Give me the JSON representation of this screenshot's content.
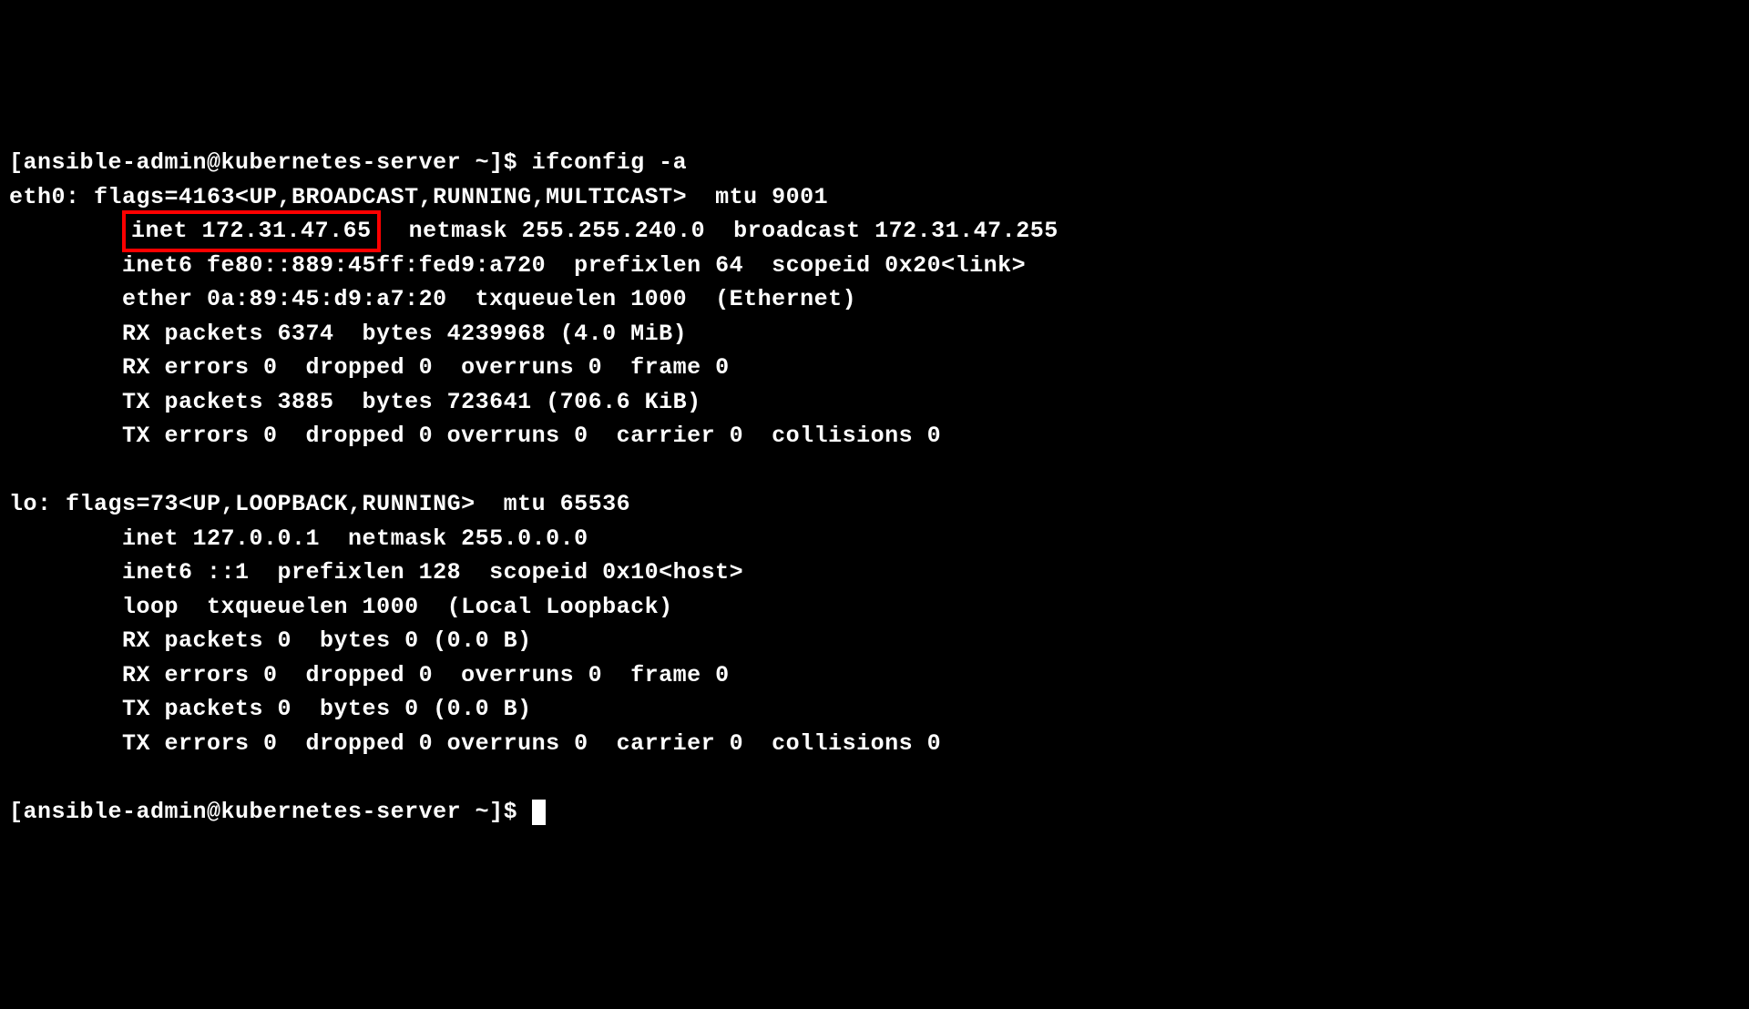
{
  "terminal": {
    "prompt1": "[ansible-admin@kubernetes-server ~]$ ",
    "command": "ifconfig -a",
    "eth0": {
      "header": "eth0: flags=4163<UP,BROADCAST,RUNNING,MULTICAST>  mtu 9001",
      "inet_pre": "        ",
      "inet_highlighted": "inet 172.31.47.65",
      "inet_post": "  netmask 255.255.240.0  broadcast 172.31.47.255",
      "inet6": "        inet6 fe80::889:45ff:fed9:a720  prefixlen 64  scopeid 0x20<link>",
      "ether": "        ether 0a:89:45:d9:a7:20  txqueuelen 1000  (Ethernet)",
      "rx_packets": "        RX packets 6374  bytes 4239968 (4.0 MiB)",
      "rx_errors": "        RX errors 0  dropped 0  overruns 0  frame 0",
      "tx_packets": "        TX packets 3885  bytes 723641 (706.6 KiB)",
      "tx_errors": "        TX errors 0  dropped 0 overruns 0  carrier 0  collisions 0"
    },
    "blank": " ",
    "lo": {
      "header": "lo: flags=73<UP,LOOPBACK,RUNNING>  mtu 65536",
      "inet": "        inet 127.0.0.1  netmask 255.0.0.0",
      "inet6": "        inet6 ::1  prefixlen 128  scopeid 0x10<host>",
      "loop": "        loop  txqueuelen 1000  (Local Loopback)",
      "rx_packets": "        RX packets 0  bytes 0 (0.0 B)",
      "rx_errors": "        RX errors 0  dropped 0  overruns 0  frame 0",
      "tx_packets": "        TX packets 0  bytes 0 (0.0 B)",
      "tx_errors": "        TX errors 0  dropped 0 overruns 0  carrier 0  collisions 0"
    },
    "prompt2": "[ansible-admin@kubernetes-server ~]$ "
  }
}
